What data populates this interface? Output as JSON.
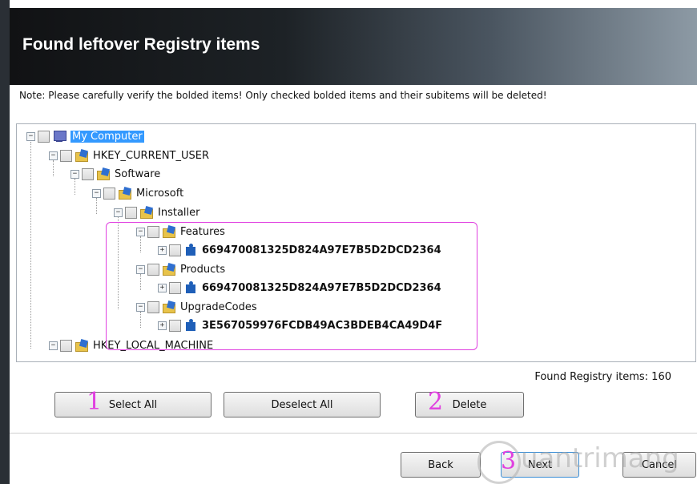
{
  "header": {
    "title": "Found leftover Registry items"
  },
  "note": "Note: Please carefully verify the bolded items! Only checked bolded items and their subitems will be deleted!",
  "tree": {
    "my_computer": "My Computer",
    "hkcu": "HKEY_CURRENT_USER",
    "software": "Software",
    "microsoft": "Microsoft",
    "installer": "Installer",
    "features": "Features",
    "features_item": "669470081325D824A97E7B5D2DCD2364",
    "products": "Products",
    "products_item": "669470081325D824A97E7B5D2DCD2364",
    "upgradecodes": "UpgradeCodes",
    "upgradecodes_item": "3E567059976FCDB49AC3BDEB4CA49D4F",
    "hklm": "HKEY_LOCAL_MACHINE"
  },
  "status": {
    "found_label": "Found Registry items:",
    "found_count": "160"
  },
  "buttons": {
    "select_all": "Select All",
    "deselect_all": "Deselect All",
    "delete": "Delete",
    "back": "Back",
    "next": "Next",
    "cancel": "Cancel"
  },
  "annotations": {
    "one": "1",
    "two": "2",
    "three": "3"
  },
  "watermark": "uantrimang",
  "colors": {
    "annotation": "#e040e0",
    "selection": "#3399ff",
    "header_dark": "#111214"
  }
}
